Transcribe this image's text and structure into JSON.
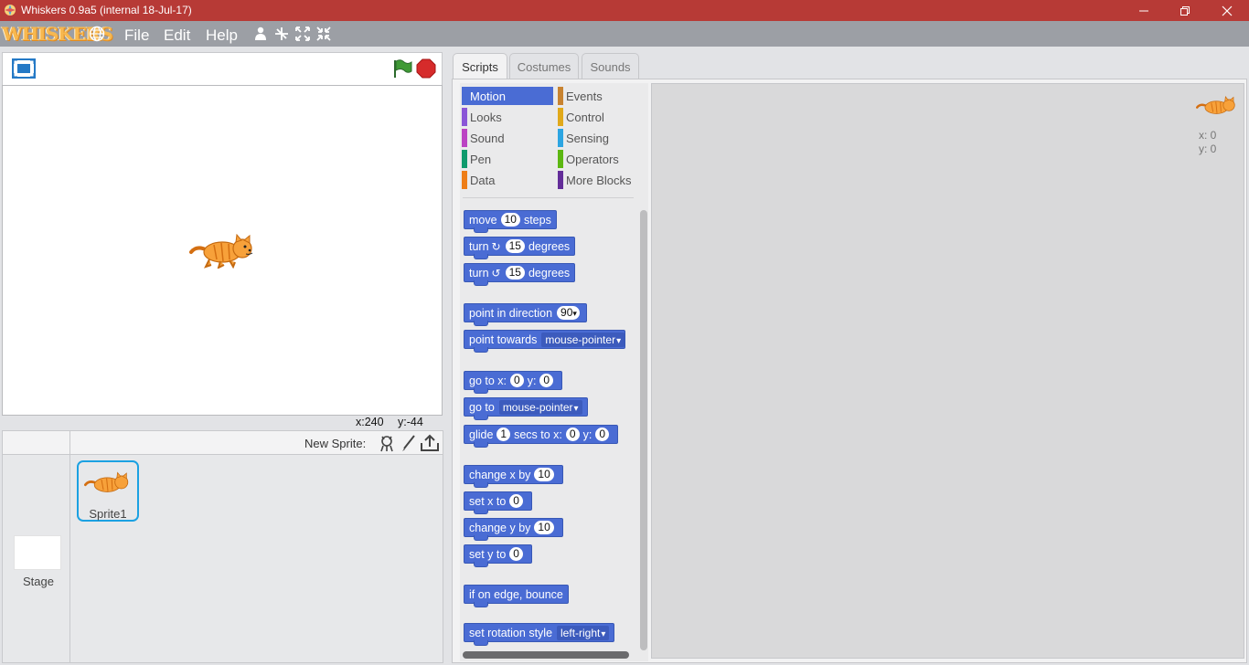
{
  "window": {
    "title": "Whiskers 0.9a5 (internal 18-Jul-17)",
    "minimize_icon": "minimize-icon",
    "restore_icon": "restore-icon",
    "close_icon": "close-icon"
  },
  "menubar": {
    "logo_text": "WHISKERS",
    "file": "File",
    "edit": "Edit",
    "help": "Help"
  },
  "stage": {
    "coords_x": "x:240",
    "coords_y": "y:-44"
  },
  "corral": {
    "new_sprite_label": "New Sprite:",
    "sprite_name": "Sprite1",
    "stage_label": "Stage"
  },
  "tabs": [
    "Scripts",
    "Costumes",
    "Sounds"
  ],
  "categories": [
    {
      "label": "Motion",
      "color": "#4a6cd4"
    },
    {
      "label": "Events",
      "color": "#c88330"
    },
    {
      "label": "Looks",
      "color": "#8a55d7"
    },
    {
      "label": "Control",
      "color": "#e1a91a"
    },
    {
      "label": "Sound",
      "color": "#bb42c3"
    },
    {
      "label": "Sensing",
      "color": "#2ca5e2"
    },
    {
      "label": "Pen",
      "color": "#0e9a6c"
    },
    {
      "label": "Operators",
      "color": "#5cb712"
    },
    {
      "label": "Data",
      "color": "#ee7d16"
    },
    {
      "label": "More Blocks",
      "color": "#632d99"
    }
  ],
  "blocks": {
    "move": {
      "pre": "move",
      "num": "10",
      "post": "steps"
    },
    "turn_cw": {
      "pre": "turn",
      "num": "15",
      "post": "degrees"
    },
    "turn_ccw": {
      "pre": "turn",
      "num": "15",
      "post": "degrees"
    },
    "point_dir": {
      "pre": "point in direction",
      "num": "90"
    },
    "point_towards": {
      "pre": "point towards",
      "dd": "mouse-pointer"
    },
    "goto_xy": {
      "pre": "go to x:",
      "x": "0",
      "mid": "y:",
      "y": "0"
    },
    "goto": {
      "pre": "go to",
      "dd": "mouse-pointer"
    },
    "glide": {
      "pre": "glide",
      "secs": "1",
      "mid1": "secs to x:",
      "x": "0",
      "mid2": "y:",
      "y": "0"
    },
    "change_x": {
      "pre": "change x by",
      "num": "10"
    },
    "set_x": {
      "pre": "set x to",
      "num": "0"
    },
    "change_y": {
      "pre": "change y by",
      "num": "10"
    },
    "set_y": {
      "pre": "set y to",
      "num": "0"
    },
    "bounce": {
      "pre": "if on edge, bounce"
    },
    "rotation": {
      "pre": "set rotation style",
      "dd": "left-right"
    }
  },
  "sprite_info": {
    "x": "x: 0",
    "y": "y: 0"
  }
}
